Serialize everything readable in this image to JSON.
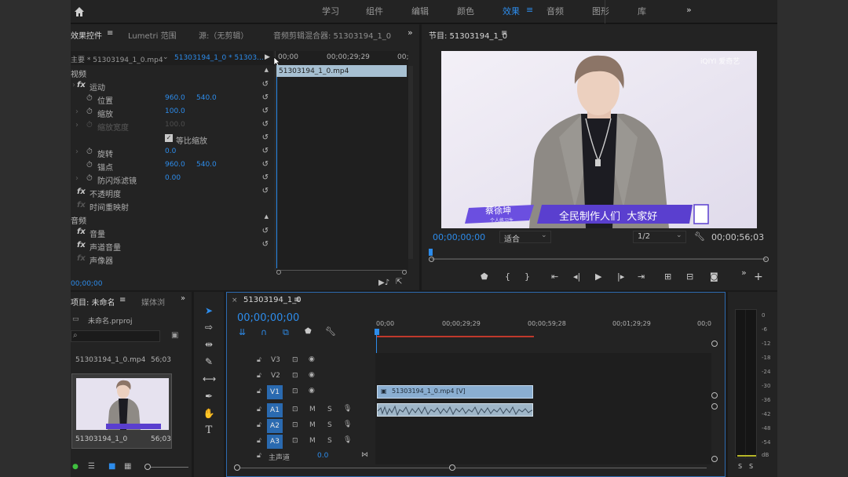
{
  "workspaces": [
    "学习",
    "组件",
    "编辑",
    "颜色",
    "效果",
    "音频",
    "图形",
    "库"
  ],
  "active_workspace": "效果",
  "more_glyph": "»",
  "effect_controls": {
    "tabs": {
      "effect_controls": "效果控件",
      "lumetri": "Lumetri 范围",
      "source": "源:（无剪辑）",
      "mixer": "音频剪辑混合器: 51303194_1_0"
    },
    "master_label": "主要 * 51303194_1_0.mp4",
    "sequence_clip": "51303194_1_0 * 51303...",
    "video_header": "视频",
    "audio_header": "音频",
    "props": {
      "motion": "运动",
      "position": "位置",
      "scale": "缩放",
      "scale_width": "缩放宽度",
      "uniform_scale": "等比缩放",
      "rotation": "旋转",
      "anchor": "锚点",
      "anti_flicker": "防闪烁滤镜",
      "opacity": "不透明度",
      "time_remap": "时间重映射",
      "volume": "音量",
      "channel_volume": "声道音量",
      "panner": "声像器"
    },
    "values": {
      "pos_x": "960.0",
      "pos_y": "540.0",
      "scale": "100.0",
      "scale_width": "100.0",
      "rotation": "0.0",
      "anchor_x": "960.0",
      "anchor_y": "540.0",
      "anti_flicker": "0.00"
    },
    "mini_ruler": {
      "start": "00;00",
      "mid": "00;00;29;29",
      "end": "00;"
    },
    "mini_clip": "51303194_1_0.mp4",
    "timecode": "00;00;00"
  },
  "program": {
    "title": "节目: 51303194_1_0",
    "timecode_left": "00;00;00;00",
    "fit": "适合",
    "resolution": "1/2",
    "timecode_right": "00;00;56;03",
    "video": {
      "name_tag": "蔡徐坤",
      "name_sub": "个人练习生",
      "caption": "全民制作人们  大家好",
      "corner_logo": "iQIYI 爱奇艺"
    }
  },
  "project": {
    "tab": "项目: 未命名",
    "tab2": "媒体浏",
    "file": "未命名.prproj",
    "search_placeholder": "",
    "item_name": "51303194_1_0.mp4",
    "item_duration": "56;03",
    "thumb_name": "51303194_1_0",
    "thumb_duration": "56;03"
  },
  "timeline": {
    "tab": "51303194_1_0",
    "timecode": "00;00;00;00",
    "ruler": [
      "00;00",
      "00;00;29;29",
      "00;00;59;28",
      "00;01;29;29",
      "00;0"
    ],
    "tracks": [
      "V3",
      "V2",
      "V1",
      "A1",
      "A2",
      "A3"
    ],
    "master": "主声道",
    "master_val": "0.0",
    "video_clip": "51303194_1_0.mp4 [V]",
    "m_label": "M",
    "s_label": "S"
  },
  "meter": {
    "labels": [
      "0",
      "-6",
      "-12",
      "-18",
      "-24",
      "-30",
      "-36",
      "-42",
      "-48",
      "-54",
      "dB"
    ],
    "solo": [
      "S",
      "S"
    ]
  },
  "colors": {
    "accent": "#2d8ceb",
    "panel": "#232323",
    "clip_video": "#8aaed1",
    "clip_audio": "#9fb6c8",
    "playhead": "#2d8ceb",
    "work_area": "#c0392b"
  }
}
